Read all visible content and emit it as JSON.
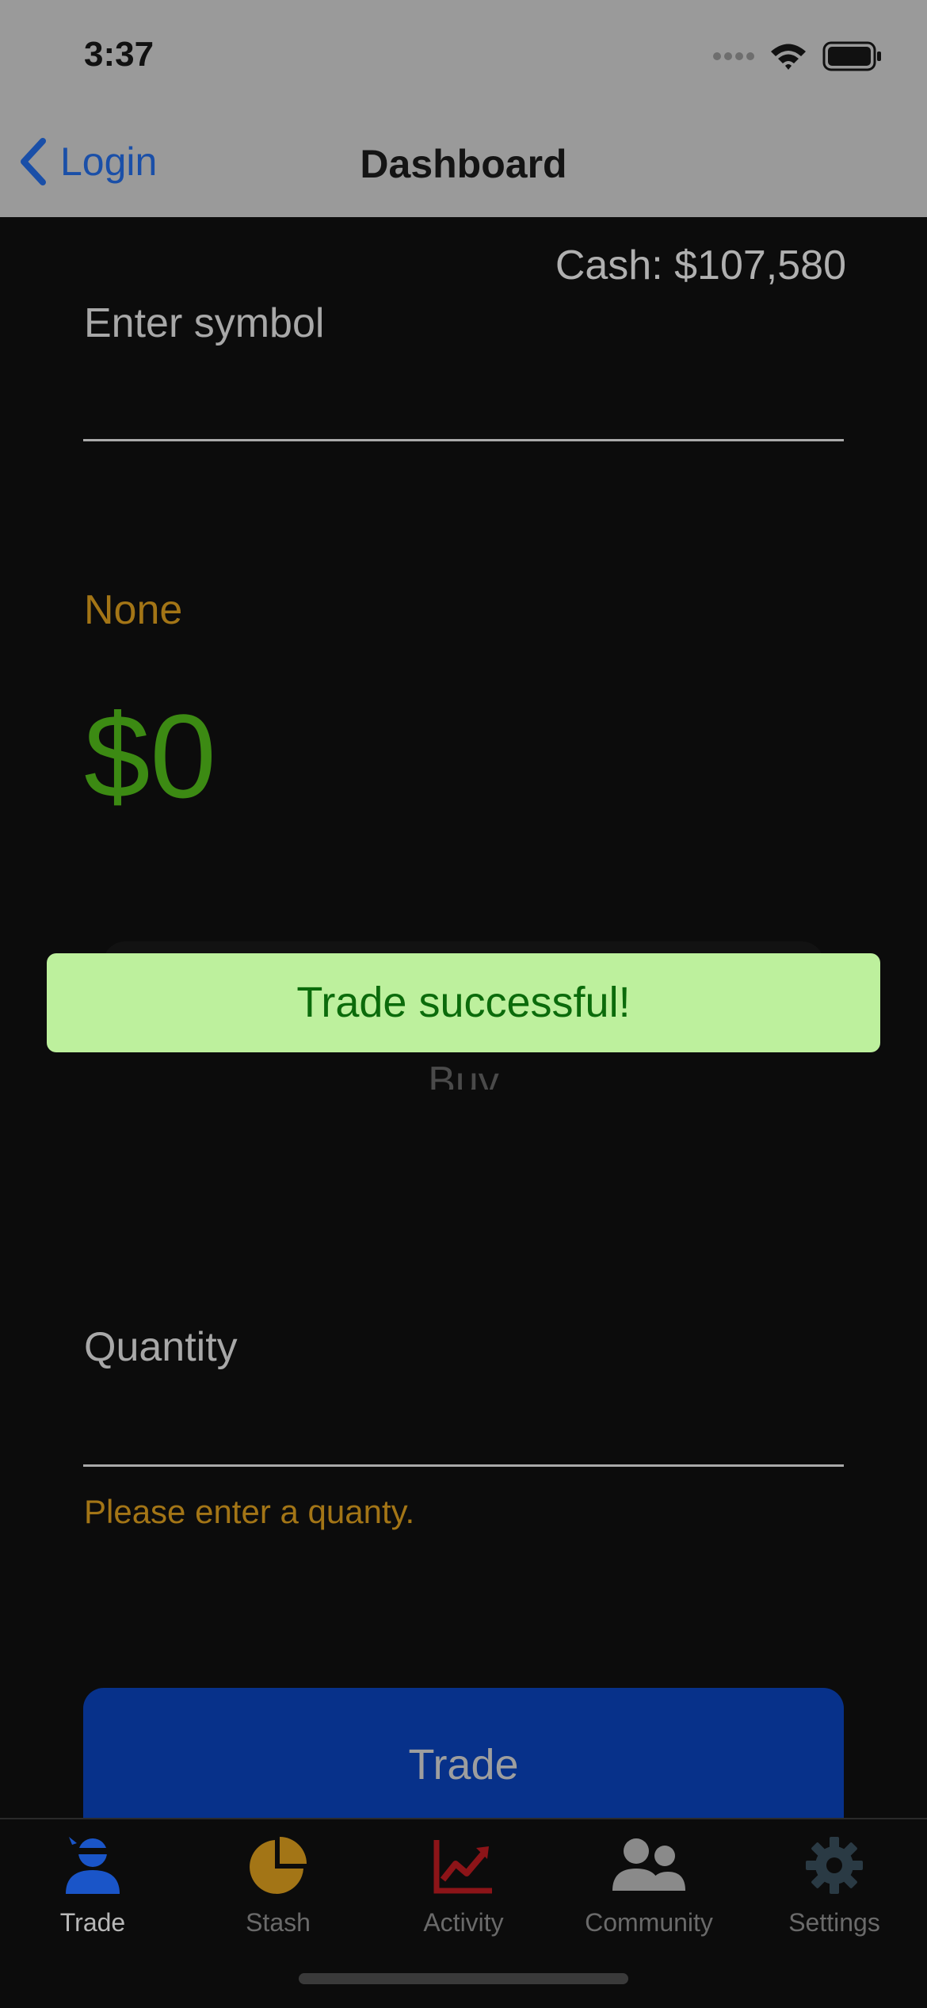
{
  "status_bar": {
    "time": "3:37",
    "signal_icon": "signal-dots-icon",
    "wifi_icon": "wifi-icon",
    "battery_icon": "battery-icon"
  },
  "nav": {
    "back_label": "Login",
    "title": "Dashboard"
  },
  "cash_label": "Cash: $107,580",
  "symbol_field": {
    "placeholder": "Enter symbol",
    "value": ""
  },
  "symbol_name": "None",
  "price": "$0",
  "buy_label": "Buy",
  "toast_message": "Trade successful!",
  "quantity_field": {
    "placeholder": "Quantity",
    "value": "",
    "hint": "Please enter a quanty."
  },
  "trade_button_label": "Trade",
  "tabs": [
    {
      "label": "Trade",
      "icon": "ninja-icon",
      "active": true,
      "color": "#1a55c8"
    },
    {
      "label": "Stash",
      "icon": "pie-chart-icon",
      "active": false,
      "color": "#a37516"
    },
    {
      "label": "Activity",
      "icon": "trend-chart-icon",
      "active": false,
      "color": "#8c1418"
    },
    {
      "label": "Community",
      "icon": "users-icon",
      "active": false,
      "color": "#8a8a8a"
    },
    {
      "label": "Settings",
      "icon": "gear-icon",
      "active": false,
      "color": "#2a3a44"
    }
  ],
  "colors": {
    "accent": "#1a4fa8",
    "toast_bg": "#bdf09d",
    "price_green": "#3c8a13",
    "warning_gold": "#a37516",
    "trade_button": "#07318a"
  }
}
